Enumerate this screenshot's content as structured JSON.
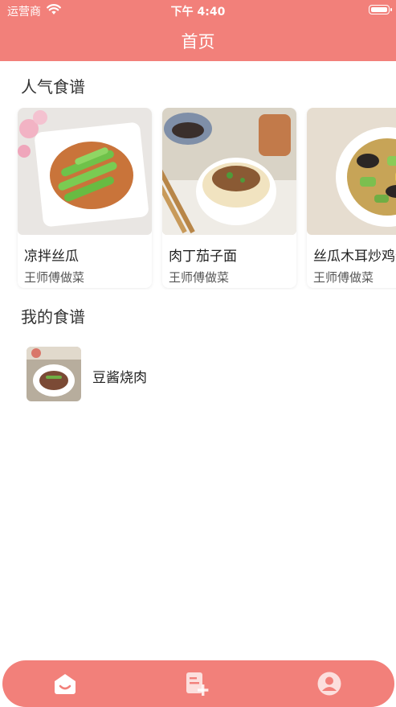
{
  "status_bar": {
    "carrier": "运营商",
    "time": "下午 4:40"
  },
  "header": {
    "title": "首页"
  },
  "popular": {
    "title": "人气食谱",
    "items": [
      {
        "name": "凉拌丝瓜",
        "author": "王师傅做菜"
      },
      {
        "name": "肉丁茄子面",
        "author": "王师傅做菜"
      },
      {
        "name": "丝瓜木耳炒鸡蛋",
        "author": "王师傅做菜"
      }
    ]
  },
  "mine": {
    "title": "我的食谱",
    "items": [
      {
        "name": "豆酱烧肉"
      }
    ]
  },
  "tabbar": {
    "tabs": [
      {
        "icon": "home-icon"
      },
      {
        "icon": "add-recipe-icon"
      },
      {
        "icon": "user-icon"
      }
    ]
  },
  "colors": {
    "brand": "#f2807a"
  }
}
